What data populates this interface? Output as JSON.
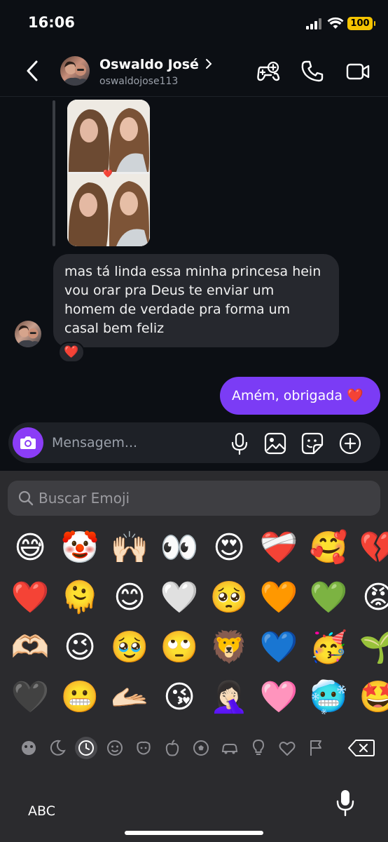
{
  "status_bar": {
    "time": "16:06",
    "battery": "100"
  },
  "header": {
    "name": "Oswaldo José",
    "username": "oswaldojose113",
    "icons": [
      "back-icon",
      "games-icon",
      "phone-icon",
      "video-icon"
    ]
  },
  "messages": [
    {
      "direction": "incoming",
      "type": "photo_reply",
      "caption_heart": "❤️"
    },
    {
      "direction": "incoming",
      "text": "mas tá linda essa minha princesa hein vou orar pra Deus te enviar um homem de verdade pra forma um casal bem feliz",
      "reaction": "❤️"
    },
    {
      "direction": "outgoing",
      "text": "Amém, obrigada ❤️"
    }
  ],
  "composer": {
    "placeholder": "Mensagem..."
  },
  "keyboard": {
    "search_placeholder": "Buscar Emoji",
    "emojis": [
      "😅",
      "🤡",
      "🙌🏻",
      "👀",
      "😍",
      "❤️‍🩹",
      "🥰",
      "💔",
      "❤️",
      "🫠",
      "😊",
      "🤍",
      "🥺",
      "🧡",
      "💚",
      "😡",
      "🫶🏻",
      "😉",
      "🥹",
      "🙄",
      "🦁",
      "💙",
      "🥳",
      "🌱",
      "🖤",
      "😬",
      "🫴🏻",
      "😘",
      "🤦🏻‍♀️",
      "🩷",
      "🥶",
      "🤩"
    ],
    "categories": [
      "smileys-icon",
      "moon-icon",
      "recent-icon",
      "face-icon",
      "animals-icon",
      "food-icon",
      "sports-icon",
      "travel-icon",
      "objects-icon",
      "heart-icon",
      "flag-icon"
    ],
    "abc_label": "ABC"
  },
  "colors": {
    "accent": "#7b3cf5",
    "background": "#0c0f14",
    "bubble_in": "#26282e",
    "keyboard": "#2b2b2e"
  }
}
